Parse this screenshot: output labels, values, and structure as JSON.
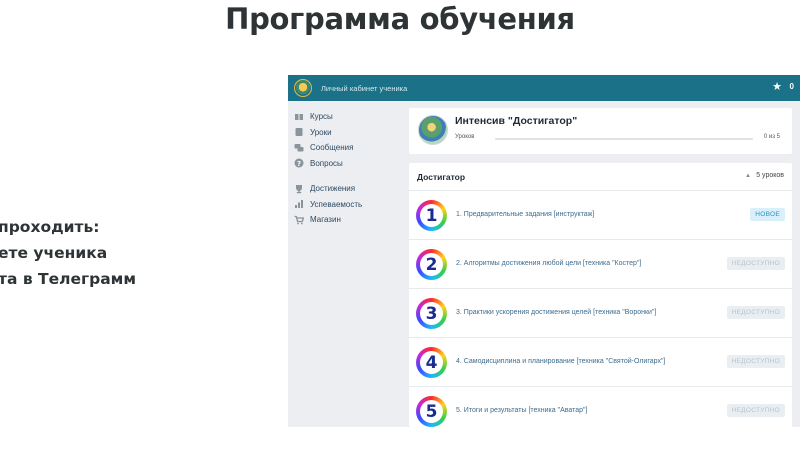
{
  "heading": "Программа обучения",
  "side_lines": [
    "проходить:",
    "ете ученика",
    "та в Телеграмм"
  ],
  "app": {
    "topbar_title": "Личный кабинет ученика",
    "star_count": "0",
    "sidebar": [
      {
        "label": "Курсы",
        "icon": "courses-icon"
      },
      {
        "label": "Уроки",
        "icon": "lessons-icon"
      },
      {
        "label": "Сообщения",
        "icon": "messages-icon"
      },
      {
        "label": "Вопросы",
        "icon": "question-icon"
      },
      {
        "label": "Достижения",
        "icon": "trophy-icon"
      },
      {
        "label": "Успеваемость",
        "icon": "chart-icon"
      },
      {
        "label": "Магазин",
        "icon": "cart-icon"
      }
    ],
    "course": {
      "title": "Интенсив \"Достигатор\"",
      "lessons_label": "Уроков",
      "progress_text": "0 из 5",
      "progress_fraction": 0
    },
    "section": {
      "title": "Достигатор",
      "lesson_count": "5 уроков",
      "lessons": [
        {
          "number": "1",
          "title": "1. Предварительные задания [инструктаж]",
          "status": "НОВОЕ"
        },
        {
          "number": "2",
          "title": "2. Алгоритмы достижения любой цели [техника \"Костер\"]",
          "status": "НЕДОСТУПНО"
        },
        {
          "number": "3",
          "title": "3. Практики ускорения достижения целей [техника \"Воронки\"]",
          "status": "НЕДОСТУПНО"
        },
        {
          "number": "4",
          "title": "4. Самодисциплина и планирование [техника \"Святой-Олигарх\"]",
          "status": "НЕДОСТУПНО"
        },
        {
          "number": "5",
          "title": "5. Итоги и результаты [техника \"Аватар\"]",
          "status": "НЕДОСТУПНО"
        }
      ]
    }
  }
}
